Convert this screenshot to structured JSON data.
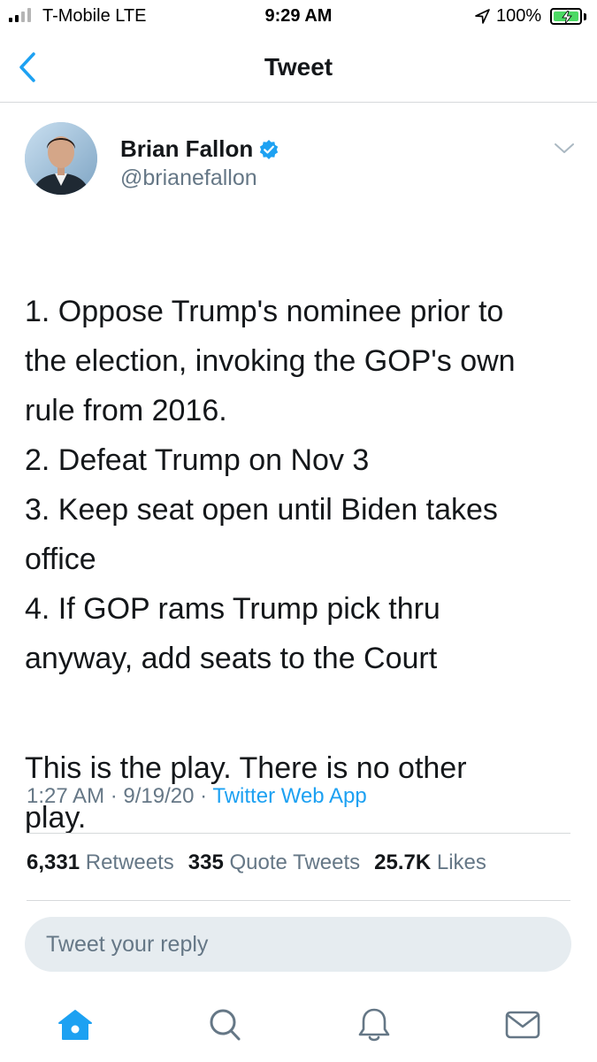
{
  "status_bar": {
    "carrier": "T-Mobile  LTE",
    "time": "9:29 AM",
    "battery": "100%",
    "battery_color": "#4cd964"
  },
  "nav": {
    "title": "Tweet",
    "back_icon": "chevron-left-icon"
  },
  "tweet": {
    "author_name": "Brian Fallon",
    "verified": true,
    "author_handle": "@brianefallon",
    "body_lines": "1. Oppose Trump's nominee prior to\nthe election, invoking the GOP's own\nrule from 2016.\n2. Defeat Trump on Nov 3\n3. Keep seat open until Biden takes\noffice\n4. If GOP rams Trump pick thru\nanyway, add seats to the Court",
    "body_para2": "This is the play. There is no other\nplay.",
    "time": "1:27 AM",
    "date": "9/19/20",
    "source": "Twitter Web App"
  },
  "stats": {
    "retweets_count": "6,331",
    "retweets_label": "Retweets",
    "quotes_count": "335",
    "quotes_label": "Quote Tweets",
    "likes_count": "25.7K",
    "likes_label": "Likes"
  },
  "reply": {
    "placeholder": "Tweet your reply"
  },
  "tab_bar": {
    "items": [
      "home-icon",
      "search-icon",
      "notifications-bell-icon",
      "messages-envelope-icon"
    ],
    "active": "home-icon"
  },
  "colors": {
    "accent": "#1da1f2",
    "secondary_text": "#657786",
    "primary_text": "#14171a",
    "reply_bg": "#e6ecf0"
  }
}
